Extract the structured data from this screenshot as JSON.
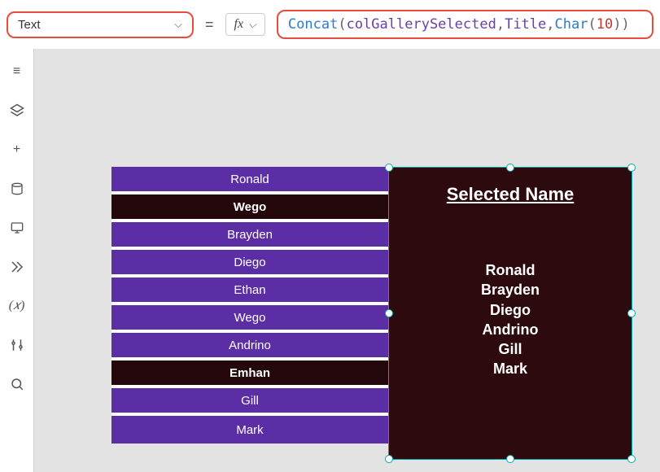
{
  "topbar": {
    "property": "Text",
    "equals": "=",
    "fx": "fx",
    "formula": {
      "fn1": "Concat",
      "lp1": "(",
      "ident1": "colGallerySelected",
      "c1": ",",
      "ident2": "Title",
      "c2": ",",
      "fn2": "Char",
      "lp2": "(",
      "num": "10",
      "rp2": ")",
      "rp1": ")"
    }
  },
  "rail": {
    "tree": "≡",
    "layers": "⧉",
    "insert": "+",
    "data": "🗄",
    "media": "🖥",
    "flows": "⟫",
    "vars": "(𝑥)",
    "settings": "⚙",
    "search": "🔍"
  },
  "gallery": {
    "rows": [
      {
        "label": "Ronald",
        "selected": true
      },
      {
        "label": "Wego",
        "selected": false
      },
      {
        "label": "Brayden",
        "selected": true
      },
      {
        "label": "Diego",
        "selected": true
      },
      {
        "label": "Ethan",
        "selected": true
      },
      {
        "label": "Wego",
        "selected": true
      },
      {
        "label": "Andrino",
        "selected": true
      },
      {
        "label": "Emhan",
        "selected": false
      },
      {
        "label": "Gill",
        "selected": true
      },
      {
        "label": "Mark",
        "selected": true
      }
    ]
  },
  "panel": {
    "title": "Selected Name",
    "names": "Ronald\nBrayden\nDiego\nAndrino\nGill\nMark"
  }
}
